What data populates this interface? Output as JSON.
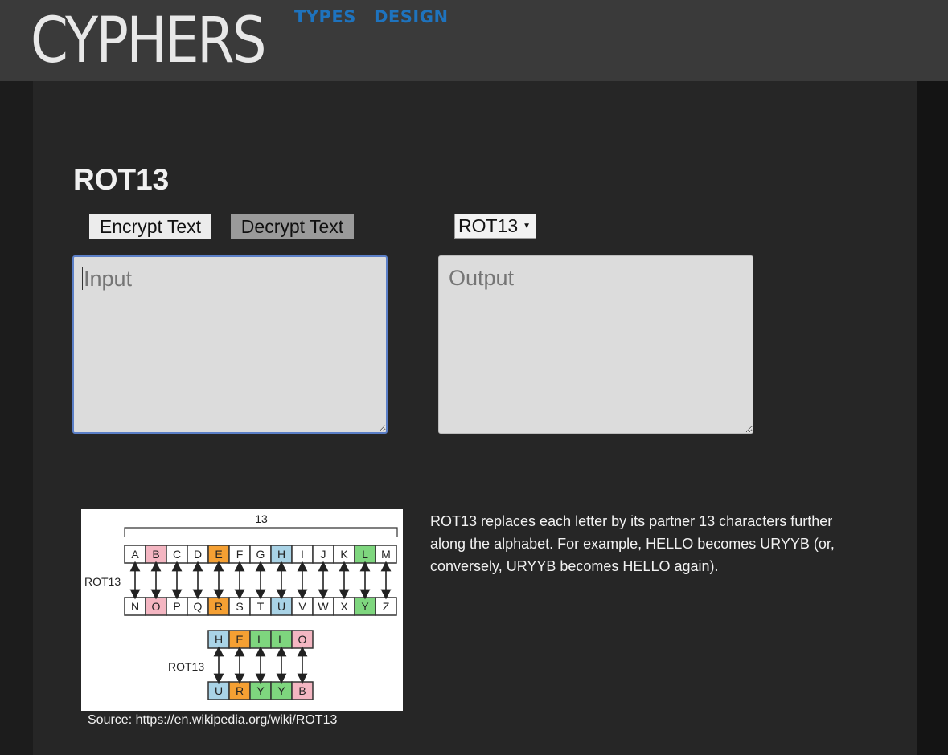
{
  "header": {
    "logo": "CYPHERS",
    "nav": [
      "TYPES",
      "DESIGN"
    ]
  },
  "main": {
    "title": "ROT13",
    "encrypt_label": "Encrypt Text",
    "decrypt_label": "Decrypt Text",
    "cipher_select": "ROT13",
    "input_placeholder": "Input",
    "output_placeholder": "Output",
    "description": "ROT13 replaces each letter by its partner 13 characters further along the alphabet. For example, HELLO becomes URYYB (or, conversely, URYYB becomes HELLO again).",
    "source": "Source: https://en.wikipedia.org/wiki/ROT13"
  },
  "diagram": {
    "shift_label": "13",
    "rot_label": "ROT13",
    "top_row": [
      "A",
      "B",
      "C",
      "D",
      "E",
      "F",
      "G",
      "H",
      "I",
      "J",
      "K",
      "L",
      "M"
    ],
    "bottom_row": [
      "N",
      "O",
      "P",
      "Q",
      "R",
      "S",
      "T",
      "U",
      "V",
      "W",
      "X",
      "Y",
      "Z"
    ],
    "word_plain": [
      "H",
      "E",
      "L",
      "L",
      "O"
    ],
    "word_cipher": [
      "U",
      "R",
      "Y",
      "Y",
      "B"
    ]
  },
  "colors": {
    "accent": "#1e73be",
    "pink": "#f4b6c2",
    "orange": "#f5a033",
    "blue": "#a9d3e6",
    "green": "#7ed67e"
  }
}
